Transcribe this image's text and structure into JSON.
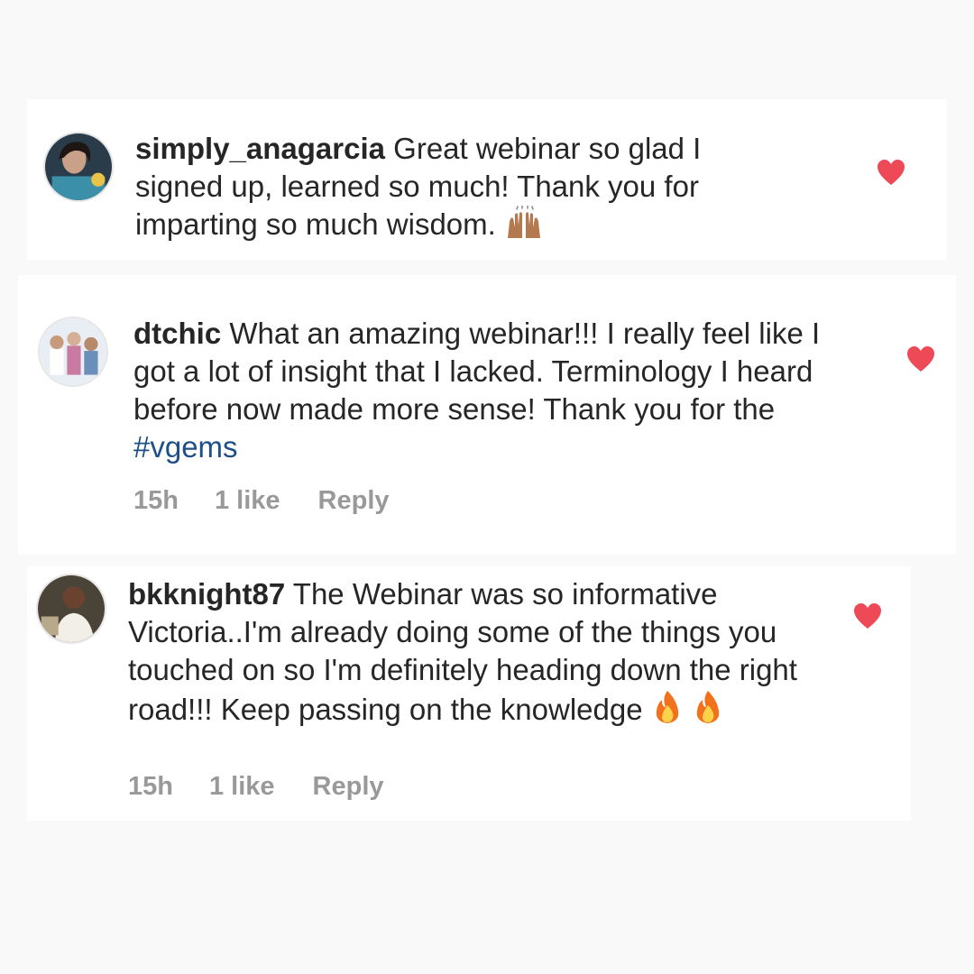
{
  "comments": [
    {
      "username": "simply_anagarcia",
      "text": "Great webinar so glad I signed up, learned so much! Thank you for imparting so much wisdom.",
      "emoji": "raising-hands",
      "liked": true,
      "heart_color": "#ed4956"
    },
    {
      "username": "dtchic",
      "text": "What an amazing webinar!!! I really feel like I got a lot of insight that I lacked. Terminology I heard before now made more sense! Thank you for the",
      "hashtag": "#vgems",
      "time": "15h",
      "likes": "1 like",
      "reply_label": "Reply",
      "liked": true,
      "heart_color": "#ed4956"
    },
    {
      "username": "bkknight87",
      "text": "The Webinar was so informative Victoria..I'm already doing some of the things you touched on so I'm definitely heading down the right road!!! Keep passing on the knowledge",
      "emoji": "fire fire",
      "time": "15h",
      "likes": "1 like",
      "reply_label": "Reply",
      "liked": true,
      "heart_color": "#ed4956"
    }
  ],
  "colors": {
    "background": "#f9f9f9",
    "card": "#ffffff",
    "text": "#262626",
    "meta": "#999999",
    "hashtag": "#1e4f86",
    "heart": "#ed4956"
  }
}
